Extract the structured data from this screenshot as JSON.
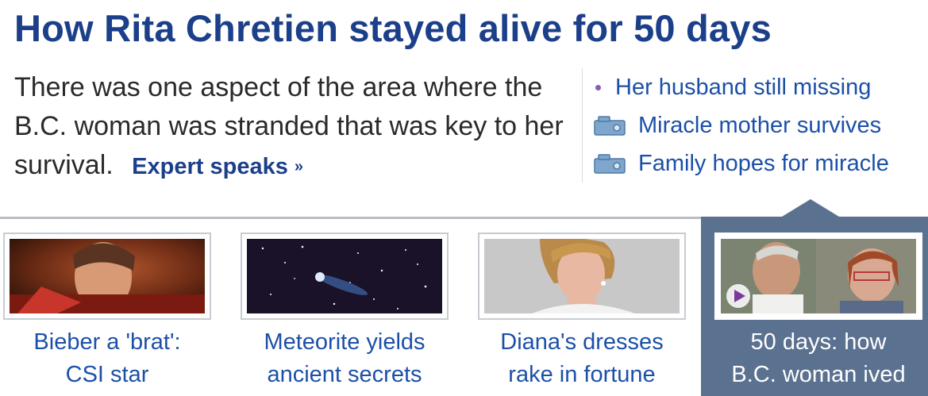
{
  "headline": "How Rita Chretien stayed alive for 50 days",
  "summary": "There was one aspect of the area where the B.C. woman was stranded that was key to her survival.",
  "expert_link": {
    "label": "Expert speaks",
    "arrow": "»"
  },
  "related": [
    {
      "label": "Her husband still missing",
      "icon": "bullet-dot"
    },
    {
      "label": "Miracle mother survives",
      "icon": "video-camera-icon"
    },
    {
      "label": "Family hopes for miracle",
      "icon": "video-camera-icon"
    }
  ],
  "tiles": [
    {
      "caption_line1": "Bieber a 'brat':",
      "caption_line2": "CSI star",
      "active": false
    },
    {
      "caption_line1": "Meteorite yields",
      "caption_line2": "ancient secrets",
      "active": false
    },
    {
      "caption_line1": "Diana's dresses",
      "caption_line2": "rake in fortune",
      "active": false
    },
    {
      "caption_line1": "50 days: how",
      "caption_line2": "B.C. woman ived",
      "active": true
    }
  ],
  "colors": {
    "headline": "#1c3f8a",
    "link": "#1c50a8",
    "active_tile_bg": "#5b7190"
  }
}
